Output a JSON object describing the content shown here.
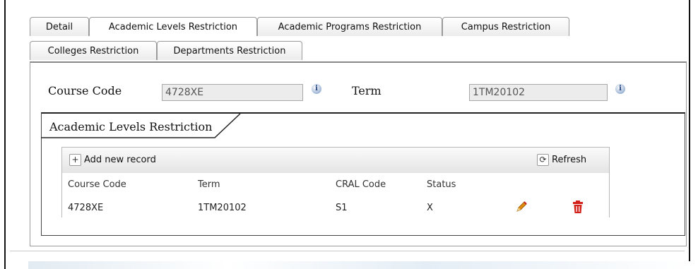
{
  "tabs": [
    {
      "label": "Detail",
      "active": false
    },
    {
      "label": "Academic Levels Restriction",
      "active": true
    },
    {
      "label": "Academic Programs Restriction",
      "active": false
    },
    {
      "label": "Campus Restriction",
      "active": false
    },
    {
      "label": "Colleges Restriction",
      "active": false
    },
    {
      "label": "Departments Restriction",
      "active": false
    }
  ],
  "form": {
    "course_code_label": "Course Code",
    "course_code_value": "4728XE",
    "term_label": "Term",
    "term_value": "1TM20102",
    "info_glyph": "i"
  },
  "section": {
    "title": "Academic Levels Restriction"
  },
  "toolbar": {
    "add_label": "Add new record",
    "add_icon": "plus-icon",
    "refresh_label": "Refresh",
    "refresh_icon": "refresh-icon"
  },
  "grid": {
    "columns": [
      "Course Code",
      "Term",
      "CRAL Code",
      "Status"
    ],
    "rows": [
      {
        "course_code": "4728XE",
        "term": "1TM20102",
        "cral_code": "S1",
        "status": "X"
      }
    ],
    "row_actions": [
      "edit-pencil-icon",
      "delete-trash-icon"
    ]
  },
  "colors": {
    "pencil": "#e08a10",
    "trash": "#d2201a"
  }
}
